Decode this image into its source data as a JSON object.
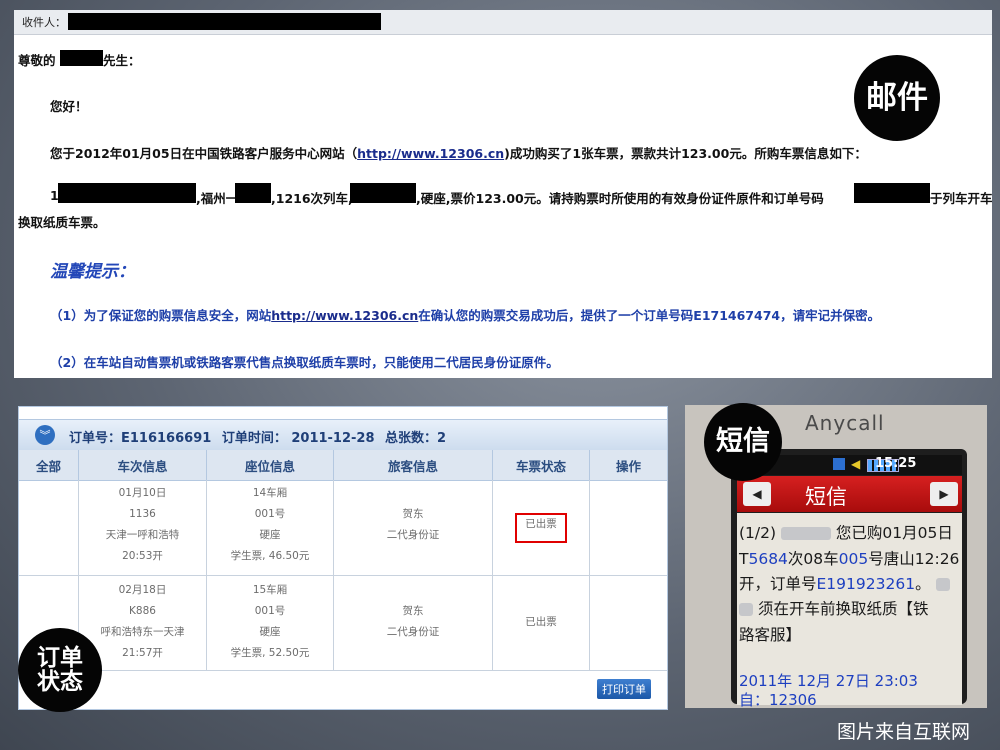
{
  "email": {
    "recipient_label": "收件人：",
    "greeting_prefix": "尊敬的",
    "greeting_suffix": "先生：",
    "hello": "您好！",
    "body_1": "您于2012年01月05日在中国铁路客户服务中心网站（",
    "body_link": "http://www.12306.cn",
    "body_2": ")成功购买了1张车票，票款共计123.00元。所购车票信息如下：",
    "ticket_idx": "1,",
    "ticket_frag_1": ",福州一",
    "ticket_frag_2": ",1216次列车,",
    "ticket_frag_3": ",硬座,票价123.00元。请持购票时所使用的有效身份证件原件和订单号码",
    "ticket_frag_4": "于列车开车",
    "ticket_cont": "换取纸质车票。",
    "tip_title": "温馨提示：",
    "tip1_a": "（1）为了保证您的购票信息安全，网站",
    "tip1_link": "http://www.12306.cn",
    "tip1_b": "在确认您的购票交易成功后，提供了一个订单号码E171467474，请牢记并保密。",
    "tip2": "（2）在车站自动售票机或铁路客票代售点换取纸质车票时，只能使用二代居民身份证原件。"
  },
  "badges": {
    "email": "邮件",
    "sms": "短信",
    "order_line1": "订单",
    "order_line2": "状态"
  },
  "order": {
    "order_no": "订单号：E116166691",
    "order_time": "订单时间：  2011-12-28",
    "total": "总张数：2",
    "columns": [
      "全部",
      "车次信息",
      "座位信息",
      "旅客信息",
      "车票状态",
      "操作"
    ],
    "rows": [
      {
        "train": [
          "01月10日",
          "1136",
          "天津一呼和浩特",
          "20:53开"
        ],
        "seat": [
          "14车厢",
          "001号",
          "硬座",
          "学生票, 46.50元"
        ],
        "passenger": [
          "贺东",
          "二代身份证"
        ],
        "status": "已出票"
      },
      {
        "train": [
          "02月18日",
          "K886",
          "呼和浩特东一天津",
          "21:57开"
        ],
        "seat": [
          "15车厢",
          "001号",
          "硬座",
          "学生票, 52.50元"
        ],
        "passenger": [
          "贺东",
          "二代身份证"
        ],
        "status": "已出票"
      }
    ],
    "print_button": "打印订单"
  },
  "phone": {
    "brand": "Anycall",
    "clock": "15:25",
    "title": "短信",
    "line1_a": "(1/2)",
    "line1_b": "您已购01月05日",
    "line2_a": "T",
    "line2_num1": "5684",
    "line2_b": "次08车",
    "line2_num2": "005",
    "line2_c": "号唐山12:26",
    "line3_a": "开，订单号",
    "line3_num": "E191923261",
    "line3_b": "。",
    "line4": "须在开车前换取纸质【铁",
    "line5": "路客服】",
    "date1": "2011年 12月 27日 23:03",
    "date2": "自：12306"
  },
  "credit": "图片来自互联网"
}
